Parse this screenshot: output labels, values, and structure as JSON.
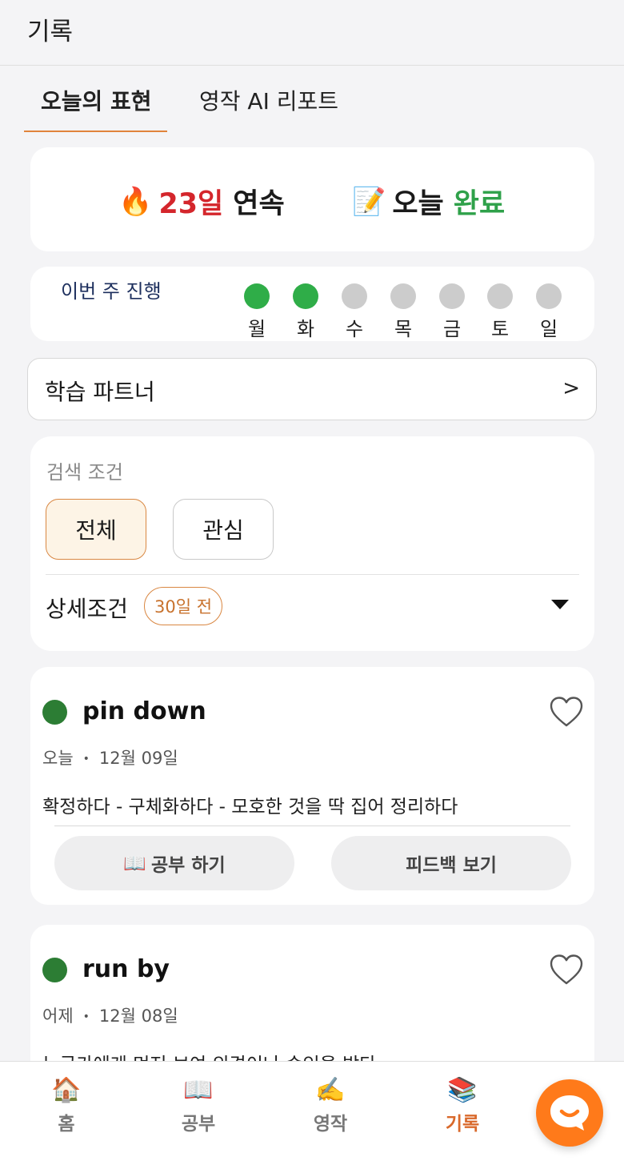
{
  "header": {
    "title": "기록"
  },
  "tabs": [
    {
      "label": "오늘의 표현",
      "active": true
    },
    {
      "label": "영작 AI 리포트",
      "active": false
    }
  ],
  "streak": {
    "fire_icon": "fire-emoji",
    "count": "23일",
    "count_suffix": "연속",
    "memo_icon": "memo-emoji",
    "today_label": "오늘",
    "today_status": "완료"
  },
  "week": {
    "label": "이번 주 진행",
    "days": [
      {
        "label": "월",
        "done": true
      },
      {
        "label": "화",
        "done": true
      },
      {
        "label": "수",
        "done": false
      },
      {
        "label": "목",
        "done": false
      },
      {
        "label": "금",
        "done": false
      },
      {
        "label": "토",
        "done": false
      },
      {
        "label": "일",
        "done": false
      }
    ]
  },
  "partner": {
    "label": "학습 파트너",
    "arrow": ">"
  },
  "filter": {
    "label": "검색 조건",
    "chips": [
      {
        "label": "전체",
        "selected": true
      },
      {
        "label": "관심",
        "selected": false
      }
    ],
    "detail_label": "상세조건",
    "detail_badge": "30일 전"
  },
  "expressions": [
    {
      "title": "pin down",
      "relative_day": "오늘",
      "separator": "•",
      "date": "12월 09일",
      "meaning": "확정하다 - 구체화하다 - 모호한 것을 딱 집어 정리하다",
      "study_icon": "📖",
      "study_label": "공부 하기",
      "feedback_label": "피드백 보기"
    },
    {
      "title": "run by",
      "relative_day": "어제",
      "separator": "•",
      "date": "12월 08일",
      "meaning": "누군가에게 먼저 보여 의견이나 승인을 받다"
    }
  ],
  "nav": [
    {
      "icon": "🏠",
      "label": "홈",
      "active": false
    },
    {
      "icon": "📖",
      "label": "공부",
      "active": false
    },
    {
      "icon": "✍️",
      "label": "영작",
      "active": false
    },
    {
      "icon": "📚",
      "label": "기록",
      "active": true
    }
  ],
  "colors": {
    "accent": "#d9692b",
    "streak_red": "#d4262c",
    "done_green": "#2fad48",
    "fab": "#ff7a1a"
  }
}
